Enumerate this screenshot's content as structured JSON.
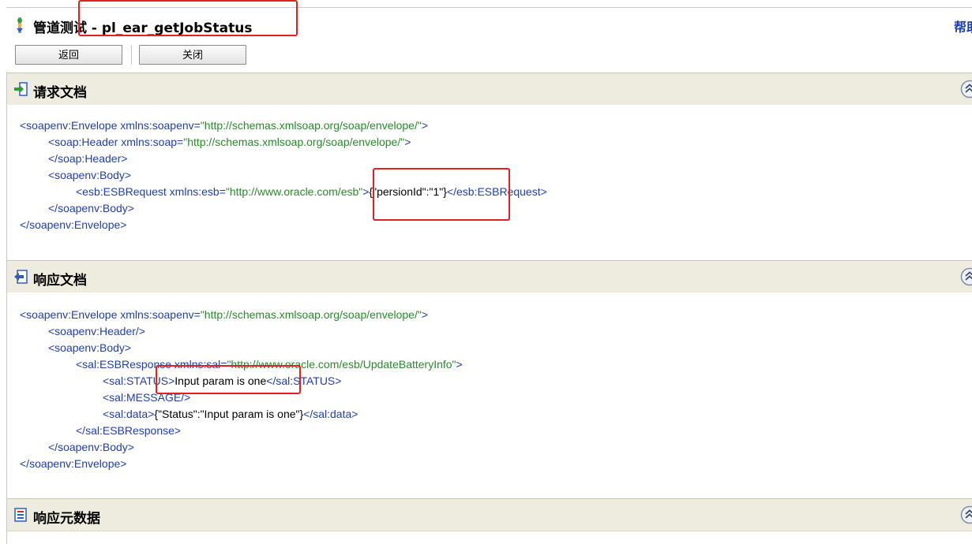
{
  "title": {
    "text": "管道测试 - pl_ear_getJobStatus",
    "help": "帮助"
  },
  "toolbar": {
    "back_label": "返回",
    "close_label": "关闭"
  },
  "sections": {
    "request": {
      "title": "请求文档"
    },
    "response": {
      "title": "响应文档"
    },
    "metadata": {
      "title": "响应元数据"
    }
  },
  "request_xml": {
    "l1_tag": "<soapenv:Envelope",
    "l1_attr": " xmlns:soapenv=",
    "l1_val": "\"http://schemas.xmlsoap.org/soap/envelope/\"",
    "l1_end": ">",
    "l2_tag": "<soap:Header",
    "l2_attr": " xmlns:soap=",
    "l2_val": "\"http://schemas.xmlsoap.org/soap/envelope/\"",
    "l2_end": ">",
    "l3": "</soap:Header>",
    "l4": "<soapenv:Body>",
    "l5_tag": "<esb:ESBRequest",
    "l5_attr": " xmlns:esb=",
    "l5_val": "\"http://www.oracle.com/esb\"",
    "l5_gt": ">",
    "l5_text": "{\"persionId\":\"1\"}",
    "l5_close": "</esb:ESBRequest>",
    "l6": "</soapenv:Body>",
    "l7": "</soapenv:Envelope>"
  },
  "response_xml": {
    "l1_tag": "<soapenv:Envelope",
    "l1_attr": " xmlns:soapenv=",
    "l1_val": "\"http://schemas.xmlsoap.org/soap/envelope/\"",
    "l1_end": ">",
    "l2": "<soapenv:Header/>",
    "l3": "<soapenv:Body>",
    "l4_tag": "<sal:ESBResponse",
    "l4_attr": " xmlns:sal=",
    "l4_val": "\"http://www.oracle.com/esb/UpdateBatteryInfo\"",
    "l4_end": ">",
    "l5_open": "<sal:STATUS>",
    "l5_text": "Input param is one",
    "l5_close": "</sal:STATUS>",
    "l6": "<sal:MESSAGE/>",
    "l7_open": "<sal:data>",
    "l7_text": "{\"Status\":\"Input param is one\"}",
    "l7_close": "</sal:data>",
    "l8": "</sal:ESBResponse>",
    "l9": "</soapenv:Body>",
    "l10": "</soapenv:Envelope>"
  },
  "colors": {
    "tag": "#1f3fb0",
    "value": "#2a8a2a",
    "section_bg": "#eeecdf",
    "highlight": "#e31f1f",
    "help_link": "#1a3fb5"
  }
}
